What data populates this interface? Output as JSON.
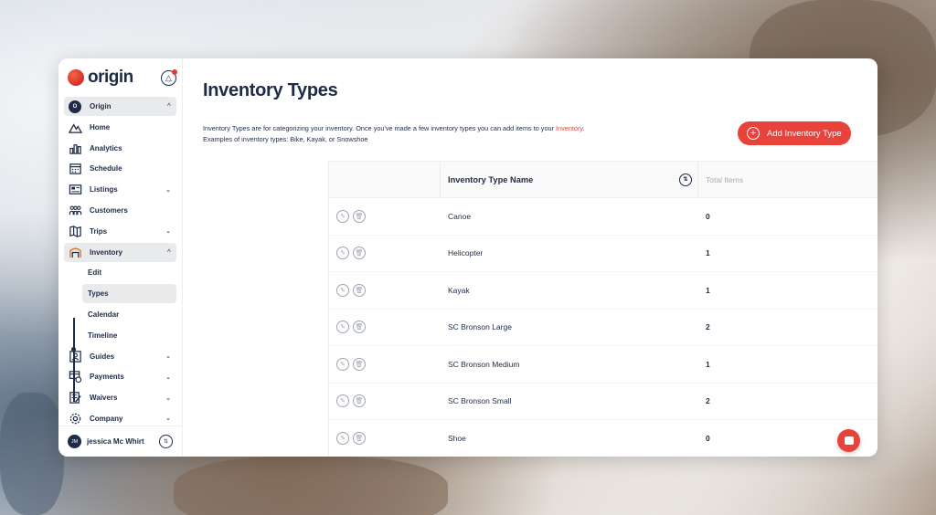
{
  "app": {
    "brand_name": "origin",
    "brand_color": "#e8423a",
    "accent_navy": "#1d2b46"
  },
  "sidebar": {
    "org": {
      "initial": "O",
      "label": "Origin"
    },
    "items": [
      {
        "label": "Home",
        "icon": "mountain-icon"
      },
      {
        "label": "Analytics",
        "icon": "bar-chart-icon"
      },
      {
        "label": "Schedule",
        "icon": "calendar-icon"
      },
      {
        "label": "Listings",
        "icon": "listing-icon"
      },
      {
        "label": "Customers",
        "icon": "users-icon"
      },
      {
        "label": "Trips",
        "icon": "map-icon"
      },
      {
        "label": "Inventory",
        "icon": "warehouse-icon"
      }
    ],
    "inventory_sub": [
      "Edit",
      "Types",
      "Calendar",
      "Timeline"
    ],
    "items_after": [
      {
        "label": "Guides",
        "icon": "badge-icon"
      },
      {
        "label": "Payments",
        "icon": "payment-icon"
      },
      {
        "label": "Waivers",
        "icon": "waiver-icon"
      },
      {
        "label": "Company",
        "icon": "gear-icon"
      }
    ],
    "user": {
      "initials": "JM",
      "name": "jessica Mc Whirt"
    }
  },
  "main": {
    "title": "Inventory Types",
    "description_part1": "Inventory Types are for categorizing your inventory. Once you've made a few inventory types you can add items to your ",
    "description_link": "Inventory",
    "description_part2": ".",
    "description_line2": "Examples of inventory types: Bike, Kayak, or Snowshoe",
    "add_button_label": "Add Inventory Type"
  },
  "table": {
    "col_name": "Inventory Type Name",
    "col_total": "Total Items",
    "rows": [
      {
        "name": "Canoe",
        "total": "0"
      },
      {
        "name": "Helicopter",
        "total": "1"
      },
      {
        "name": "Kayak",
        "total": "1"
      },
      {
        "name": "SC Bronson Large",
        "total": "2"
      },
      {
        "name": "SC Bronson Medium",
        "total": "1"
      },
      {
        "name": "SC Bronson Small",
        "total": "2"
      },
      {
        "name": "Shoe",
        "total": "0"
      }
    ]
  }
}
